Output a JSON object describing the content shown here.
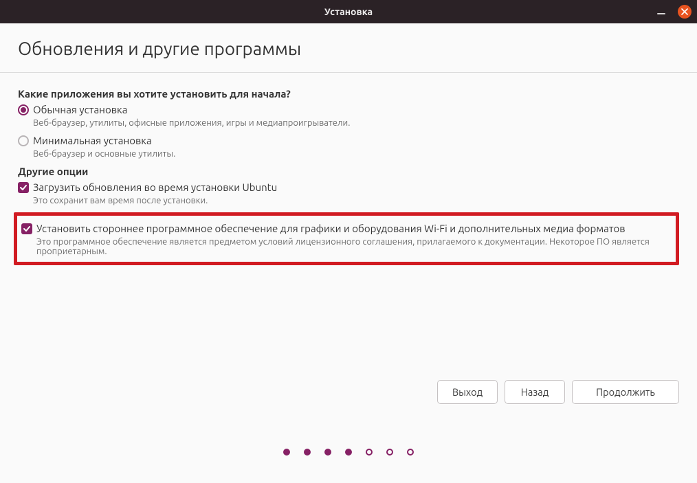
{
  "window": {
    "title": "Установка"
  },
  "page": {
    "title": "Обновления и другие программы"
  },
  "sections": {
    "apps_question": "Какие приложения вы хотите установить для начала?",
    "normal_install": {
      "label": "Обычная установка",
      "desc": "Веб-браузер, утилиты, офисные приложения, игры и медиапроигрыватели."
    },
    "minimal_install": {
      "label": "Минимальная установка",
      "desc": "Веб-браузер и основные утилиты."
    },
    "other_options": "Другие опции",
    "download_updates": {
      "label": "Загрузить обновления во время установки Ubuntu",
      "desc": "Это сохранит вам время после установки."
    },
    "third_party": {
      "label": "Установить стороннее программное обеспечение для графики и оборудования Wi-Fi и дополнительных медиа форматов",
      "desc": "Это программное обеспечение является предметом условий лицензионного соглашения, прилагаемого к документации. Некоторое ПО является проприетарным."
    }
  },
  "buttons": {
    "quit": "Выход",
    "back": "Назад",
    "continue": "Продолжить"
  },
  "pager": {
    "total": 7,
    "current": 4
  }
}
